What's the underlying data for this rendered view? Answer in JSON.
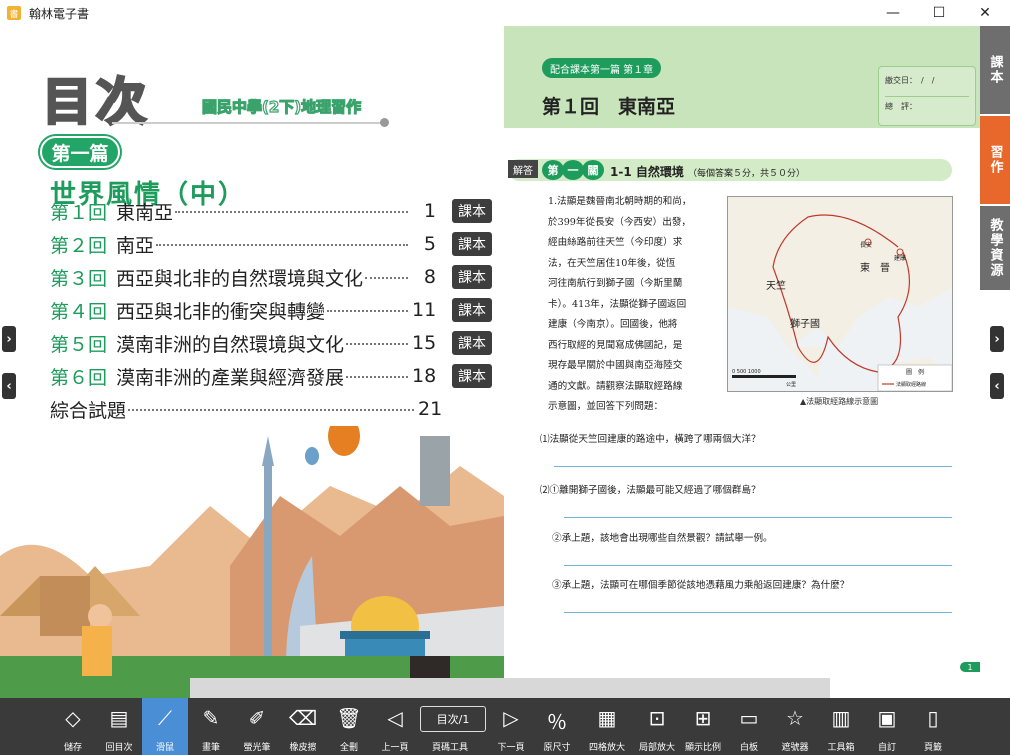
{
  "window": {
    "title": "翰林電子書",
    "minimize": "—",
    "maximize": "☐",
    "close": "✕"
  },
  "toc": {
    "title": "目次",
    "subtitle": "國民中學(2下)地理習作",
    "part_label": "第一篇",
    "part_title": "世界風情（中）",
    "rows": [
      {
        "num": "第１回",
        "name": "東南亞",
        "page": "1",
        "tag": "課本"
      },
      {
        "num": "第２回",
        "name": "南亞",
        "page": "5",
        "tag": "課本"
      },
      {
        "num": "第３回",
        "name": "西亞與北非的自然環境與文化",
        "page": "8",
        "tag": "課本"
      },
      {
        "num": "第４回",
        "name": "西亞與北非的衝突與轉變",
        "page": "11",
        "tag": "課本"
      },
      {
        "num": "第５回",
        "name": "漠南非洲的自然環境與文化",
        "page": "15",
        "tag": "課本"
      },
      {
        "num": "第６回",
        "name": "漠南非洲的產業與經濟發展",
        "page": "18",
        "tag": "課本"
      },
      {
        "num": "",
        "name": "綜合試題",
        "page": "21",
        "tag": ""
      }
    ]
  },
  "worksheet": {
    "chapter_pill": "配合課本第一篇 第１章",
    "lesson_title": "第１回　東南亞",
    "date_label": "繳交日：　/　/",
    "score_label": "總　評：",
    "answer_badge": "解答",
    "level_chars": [
      "第",
      "一",
      "關"
    ],
    "section_title": "1-1 自然環境",
    "section_note": "（每個答案５分，共５０分）",
    "question1_lines": [
      "1.法顯是魏晉南北朝時期的和尚，",
      "於399年從長安（今西安）出發，",
      "經由絲路前往天竺（今印度）求",
      "法，在天竺居住10年後，從恆",
      "河往南航行到獅子國（今斯里蘭",
      "卡）。413年，法顯從獅子國返回",
      "建康（今南京）。回國後，他將",
      "西行取經的見聞寫成佛國記，是",
      "現存最早關於中國與南亞海陸交",
      "通的文獻。請觀察法顯取經路線",
      "示意圖，並回答下列問題："
    ],
    "map_labels": {
      "tianzhu": "天竺",
      "dongjin": "東　晉",
      "shizi": "獅子國",
      "changan": "長安",
      "jiankang": "建康",
      "legend_title": "圖　例",
      "legend_item": "法顯取經路線",
      "scale": "0    500   1000",
      "scale_unit": "公里"
    },
    "map_caption": "▲法顯取經路線示意圖",
    "sub_questions": [
      "⑴法顯從天竺回建康的路途中，橫跨了哪兩個大洋？",
      "⑵①離開獅子國後，法顯最可能又經過了哪個群島？",
      "②承上題，該地會出現哪些自然景觀？請試舉一例。",
      "③承上題，法顯可在哪個季節從該地憑藉風力乘船返回建康？為什麼？"
    ],
    "page_number": "1"
  },
  "side_tabs": [
    "課本",
    "習作",
    "教學資源"
  ],
  "toolbar": {
    "page_indicator": "目次/1",
    "tools": [
      "儲存",
      "回目次",
      "滑鼠",
      "畫筆",
      "螢光筆",
      "橡皮擦",
      "全刪",
      "上一頁",
      "頁碼工具",
      "下一頁",
      "原尺寸",
      "四格放大",
      "局部放大",
      "顯示比例",
      "白板",
      "遮號器",
      "工具箱",
      "自訂",
      "頁籤"
    ],
    "active_tool": "滑鼠"
  },
  "colors": {
    "accent_green": "#1e9c5c",
    "header_green": "#c7e4ba",
    "tab_grey": "#6e6e6e",
    "tab_orange": "#e8672a",
    "toolbar": "#3a3a3a",
    "active": "#4a8fd6"
  }
}
